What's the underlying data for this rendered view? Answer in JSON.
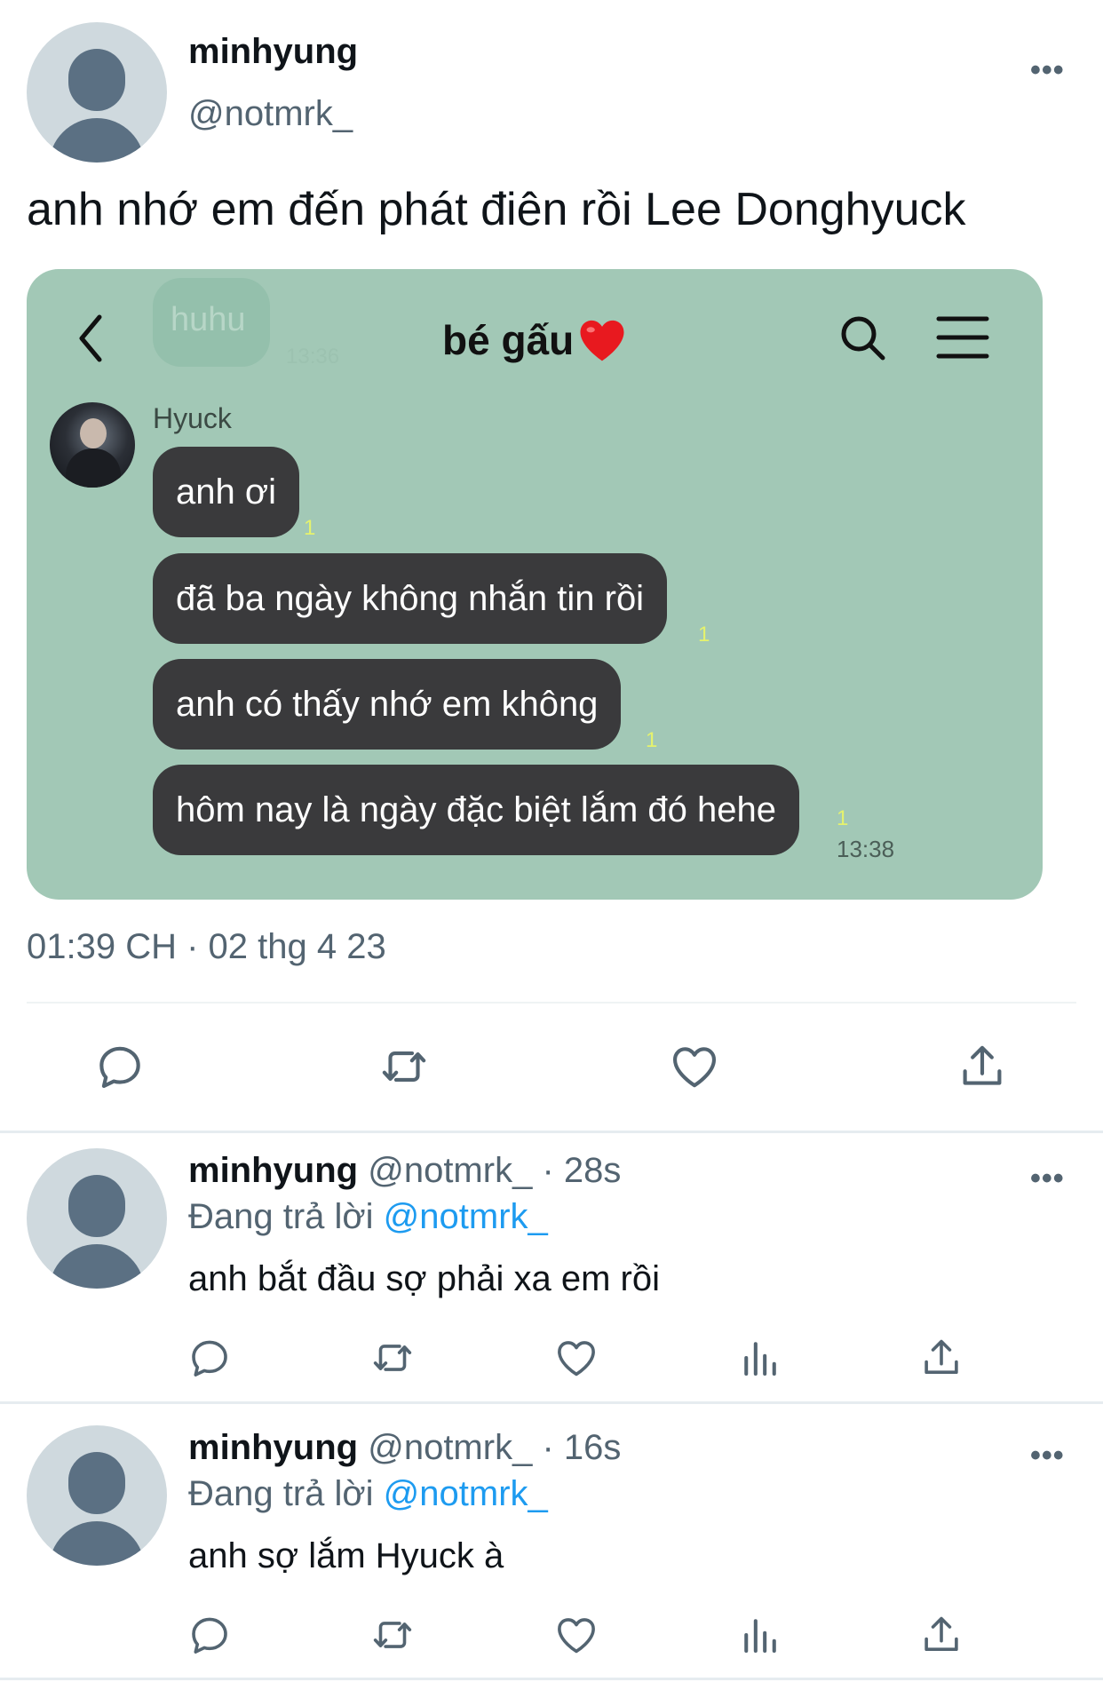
{
  "main_tweet": {
    "name": "minhyung",
    "handle": "@notmrk_",
    "text": "anh nhớ em đến phát điên rồi Lee Donghyuck",
    "timestamp": "01:39 CH · 02 thg 4 23"
  },
  "chat": {
    "title": "bé gấu",
    "faded_bubble": "huhu",
    "faded_time": "13:36",
    "sender": "Hyuck",
    "messages": [
      {
        "text": "anh ơi",
        "unread": "1"
      },
      {
        "text": "đã ba ngày không nhắn tin rồi",
        "unread": "1"
      },
      {
        "text": "anh có thấy nhớ em không",
        "unread": "1"
      },
      {
        "text": "hôm nay là ngày đặc biệt lắm đó hehe",
        "unread": "1"
      }
    ],
    "last_time": "13:38",
    "colors": {
      "background": "#a2c8b6",
      "bubble": "#3a3a3c",
      "unread": "#e5f26d"
    }
  },
  "replies": [
    {
      "name": "minhyung",
      "handle": "@notmrk_",
      "time": "· 28s",
      "replying_label": "Đang trả lời",
      "replying_to": "@notmrk_",
      "text": "anh bắt đầu sợ phải xa em rồi"
    },
    {
      "name": "minhyung",
      "handle": "@notmrk_",
      "time": "· 16s",
      "replying_label": "Đang trả lời",
      "replying_to": "@notmrk_",
      "text": "anh sợ lắm Hyuck à"
    }
  ],
  "more_glyph": "•••",
  "icons": [
    "comment-icon",
    "retweet-icon",
    "like-icon",
    "views-icon",
    "share-icon",
    "back-arrow-icon",
    "search-icon",
    "menu-icon",
    "heart-emoji-icon"
  ]
}
